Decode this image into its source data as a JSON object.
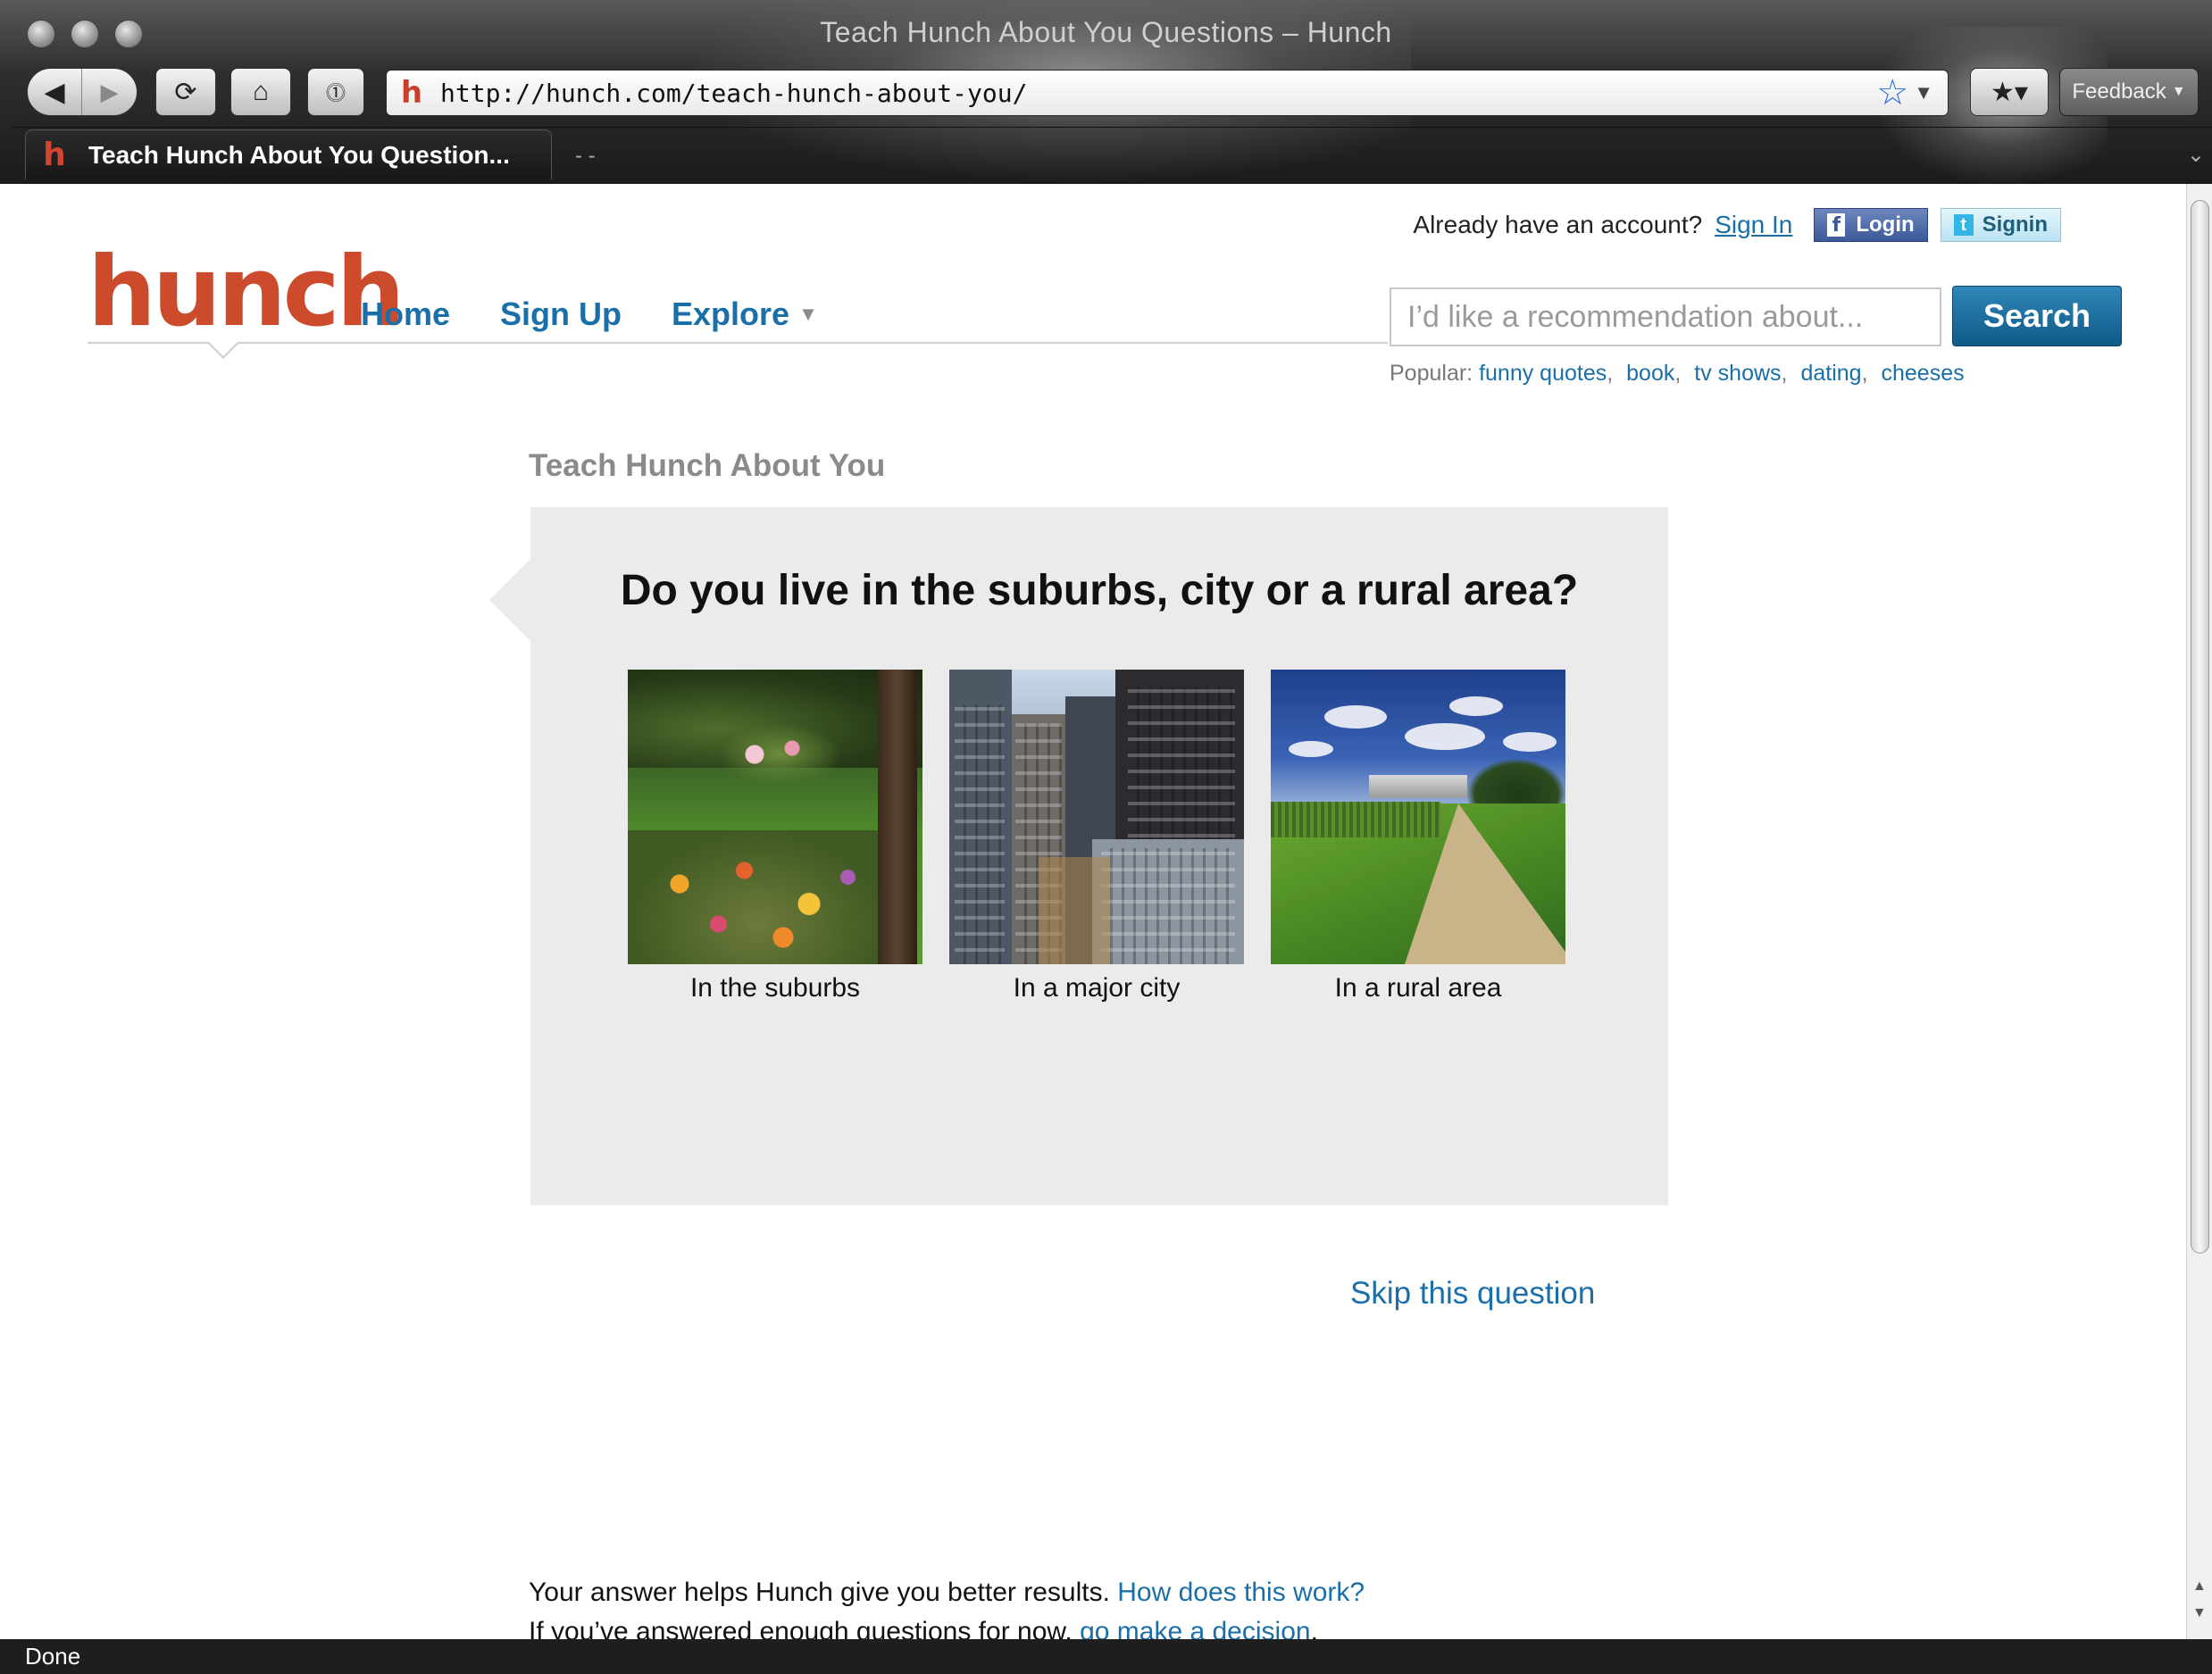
{
  "window": {
    "title": "Teach Hunch About You Questions – Hunch",
    "url": "http://hunch.com/teach-hunch-about-you/",
    "tab_title": "Teach Hunch About You Question...",
    "feedback_label": "Feedback",
    "status_text": "Done"
  },
  "header": {
    "account_prompt": "Already have an account?",
    "sign_in_label": "Sign In",
    "facebook_login_label": "Login",
    "twitter_signin_label": "Signin",
    "logo_text": "hunch",
    "nav": [
      {
        "label": "Home"
      },
      {
        "label": "Sign Up"
      },
      {
        "label": "Explore"
      }
    ],
    "search_placeholder": "I’d like a recommendation about...",
    "search_button_label": "Search",
    "popular_label": "Popular:",
    "popular_links": [
      "funny quotes",
      "book",
      "tv shows",
      "dating",
      "cheeses"
    ]
  },
  "main": {
    "section_title": "Teach Hunch About You",
    "question": "Do you live in the suburbs, city or a rural area?",
    "choices": [
      {
        "label": "In the suburbs"
      },
      {
        "label": "In a major city"
      },
      {
        "label": "In a rural area"
      }
    ],
    "skip_label": "Skip this question",
    "footer_line1": "Your answer helps Hunch give you better results.",
    "footer_link1": "How does this work?",
    "footer_line2": "If you’ve answered enough questions for now,",
    "footer_link2": "go make a decision",
    "footer_period": "."
  },
  "colors": {
    "brand": "#cc4b2c",
    "link": "#1b6fa8",
    "search_button": "#0f5a88",
    "question_bg": "#ebebeb"
  }
}
